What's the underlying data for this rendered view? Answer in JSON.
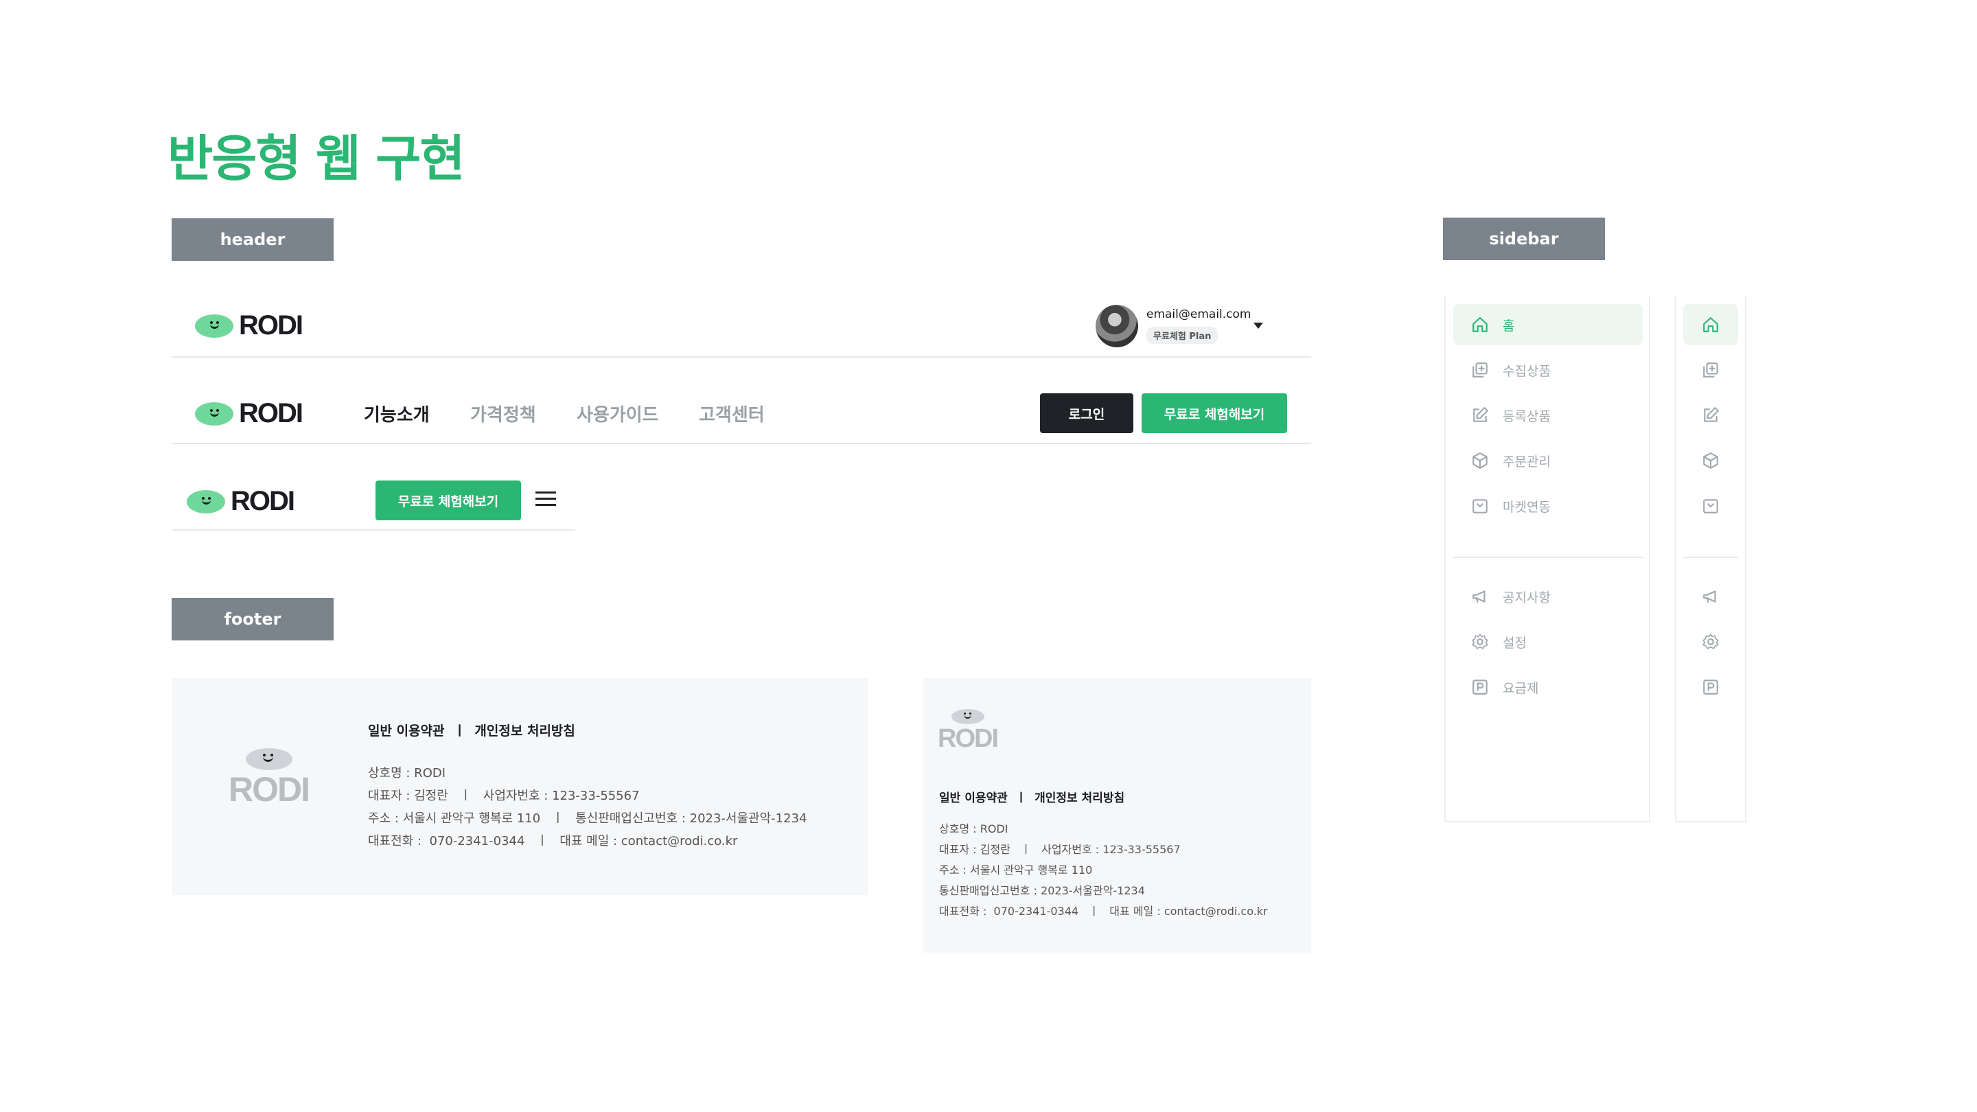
{
  "page": {
    "title": "반응형 웹 구현"
  },
  "labels": {
    "header": "header",
    "footer": "footer",
    "sidebar": "sidebar"
  },
  "brand": {
    "name": "RODI",
    "primary": "#2bb673",
    "dark": "#1f2226",
    "label_bg": "#7b838c"
  },
  "header_user": {
    "email": "email@email.com",
    "plan": "무료체험 Plan"
  },
  "header_desktop": {
    "nav": [
      "기능소개",
      "가격정책",
      "사용가이드",
      "고객센터"
    ],
    "login": "로그인",
    "free_trial": "무료로 체험해보기"
  },
  "header_mobile": {
    "free_trial": "무료로 체험해보기"
  },
  "footer": {
    "links": "일반 이용약관  ㅣ  개인정보 처리방침",
    "wide": [
      "상호명 : RODI",
      "대표자 : 김정란   ㅣ   사업자번호 : 123-33-55567",
      "주소 : 서울시 관악구 행복로 110   ㅣ   통신판매업신고번호 : 2023-서울관악-1234",
      "대표전화 :  070-2341-0344   ㅣ   대표 메일 : contact@rodi.co.kr"
    ],
    "narrow": [
      "상호명 : RODI",
      "대표자 : 김정란   ㅣ   사업자번호 : 123-33-55567",
      "주소 : 서울시 관악구 행복로 110",
      "통신판매업신고번호 : 2023-서울관악-1234",
      "대표전화 :  070-2341-0344   ㅣ   대표 메일 : contact@rodi.co.kr"
    ]
  },
  "sidebar": {
    "items": [
      {
        "label": "홈",
        "icon": "home-icon"
      },
      {
        "label": "수집상품",
        "icon": "collect-icon"
      },
      {
        "label": "등록상품",
        "icon": "edit-icon"
      },
      {
        "label": "주문관리",
        "icon": "box-icon"
      },
      {
        "label": "마켓연동",
        "icon": "market-icon"
      }
    ],
    "bottom_items": [
      {
        "label": "공지사항",
        "icon": "megaphone-icon"
      },
      {
        "label": "설정",
        "icon": "gear-icon"
      },
      {
        "label": "요금제",
        "icon": "plan-icon"
      }
    ]
  }
}
